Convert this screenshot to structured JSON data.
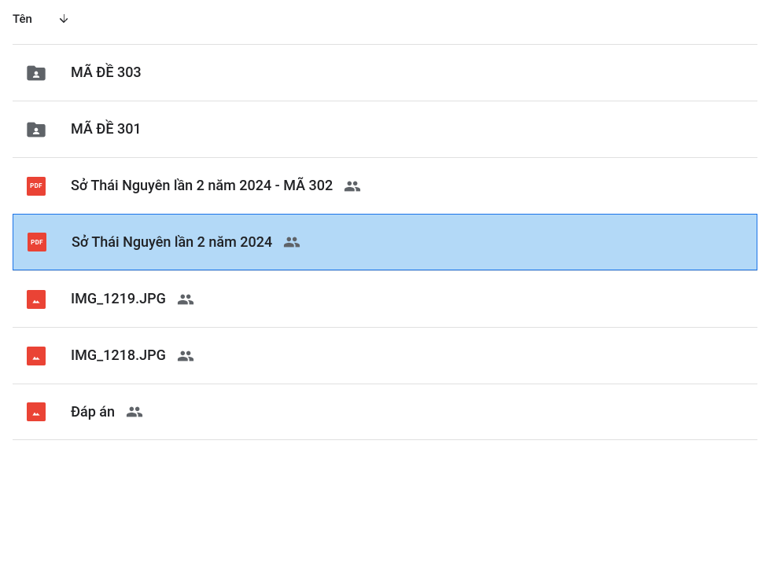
{
  "header": {
    "column_name": "Tên"
  },
  "files": [
    {
      "type": "folder",
      "name": "MÃ ĐỀ 303",
      "shared": false,
      "selected": false
    },
    {
      "type": "folder",
      "name": "MÃ ĐỀ 301",
      "shared": false,
      "selected": false
    },
    {
      "type": "pdf",
      "name": "Sở Thái Nguyên lần 2 năm 2024 - MÃ 302",
      "shared": true,
      "selected": false
    },
    {
      "type": "pdf",
      "name": "Sở Thái Nguyên lần 2 năm 2024",
      "shared": true,
      "selected": true
    },
    {
      "type": "image",
      "name": "IMG_1219.JPG",
      "shared": true,
      "selected": false
    },
    {
      "type": "image",
      "name": "IMG_1218.JPG",
      "shared": true,
      "selected": false
    },
    {
      "type": "image",
      "name": "Đáp án",
      "shared": true,
      "selected": false
    }
  ],
  "icons": {
    "pdf_label": "PDF"
  }
}
